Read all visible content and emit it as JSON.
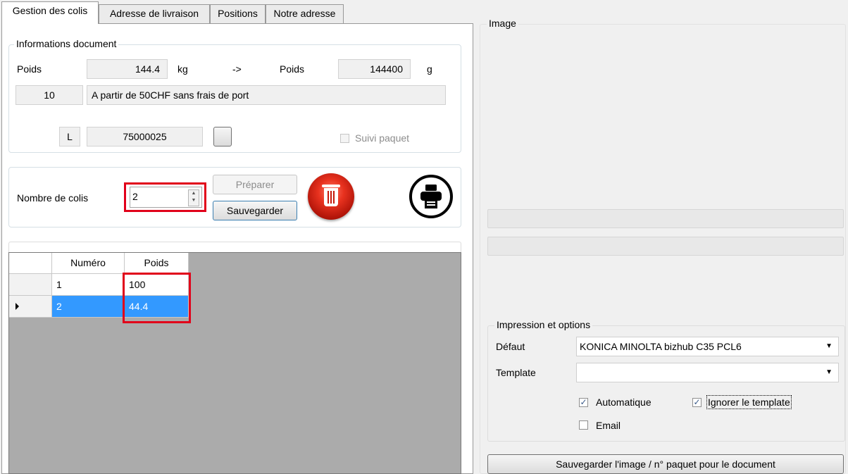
{
  "tabs": [
    {
      "label": "Gestion des colis",
      "active": true
    },
    {
      "label": "Adresse de livraison",
      "active": false
    },
    {
      "label": "Positions",
      "active": false
    },
    {
      "label": "Notre adresse",
      "active": false
    }
  ],
  "document_info": {
    "legend": "Informations document",
    "weight_label": "Poids",
    "weight_kg": "144.4",
    "unit_kg": "kg",
    "arrow": "->",
    "weight_label_2": "Poids",
    "weight_g": "144400",
    "unit_g": "g",
    "shipping_code": "10",
    "shipping_text": "A partir de 50CHF sans frais de port",
    "tracking_prefix": "L",
    "tracking_number": "75000025",
    "track_label": "Suivi paquet"
  },
  "packages": {
    "count_label": "Nombre de colis",
    "count_value": "2",
    "prepare_label": "Préparer",
    "save_label": "Sauvegarder"
  },
  "grid": {
    "headers": [
      "Numéro",
      "Poids"
    ],
    "rows": [
      {
        "number": "1",
        "weight": "100"
      },
      {
        "number": "2",
        "weight": "44.4"
      }
    ]
  },
  "image_panel": {
    "legend": "Image"
  },
  "print_options": {
    "legend": "Impression et options",
    "default_label": "Défaut",
    "printer": "KONICA MINOLTA bizhub C35 PCL6",
    "template_label": "Template",
    "template_value": "",
    "automatic_label": "Automatique",
    "automatic_checked": true,
    "ignore_label": "Ignorer le template",
    "ignore_checked": true,
    "email_label": "Email",
    "email_checked": false
  },
  "save_image_button": "Sauvegarder l'image / n° paquet pour le document",
  "colors": {
    "highlight": "#e1001a",
    "selection": "#3399ff",
    "grid_background": "#ababab"
  }
}
